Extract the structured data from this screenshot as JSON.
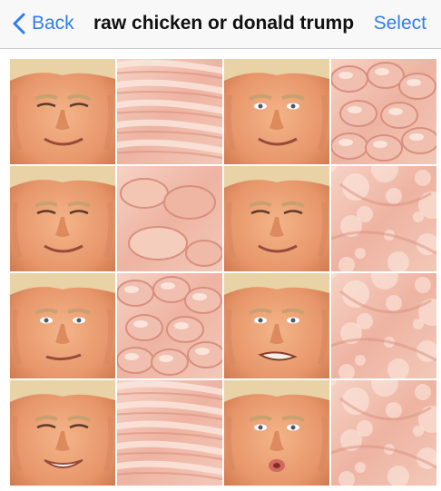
{
  "nav": {
    "back_label": "Back",
    "title": "raw chicken or donald trump",
    "select_label": "Select",
    "accent_color": "#2f7cf6"
  },
  "grid": {
    "rows": 4,
    "columns": 4,
    "tiles": [
      {
        "kind": "face",
        "expression": "smile-closed-eyes",
        "name": "photo-trump-face"
      },
      {
        "kind": "chicken",
        "variant": "breast-fillets",
        "name": "photo-raw-chicken"
      },
      {
        "kind": "face",
        "expression": "smile",
        "name": "photo-trump-face"
      },
      {
        "kind": "chicken",
        "variant": "chunks",
        "name": "photo-raw-chicken"
      },
      {
        "kind": "face",
        "expression": "grin-squint",
        "name": "photo-trump-face"
      },
      {
        "kind": "chicken",
        "variant": "drumsticks",
        "name": "photo-raw-chicken"
      },
      {
        "kind": "face",
        "expression": "squint",
        "name": "photo-trump-face"
      },
      {
        "kind": "chicken",
        "variant": "skin-closeup",
        "name": "photo-raw-chicken"
      },
      {
        "kind": "face",
        "expression": "smirk",
        "name": "photo-trump-face"
      },
      {
        "kind": "chicken",
        "variant": "diced",
        "name": "photo-raw-chicken"
      },
      {
        "kind": "face",
        "expression": "grimace",
        "name": "photo-trump-face"
      },
      {
        "kind": "chicken",
        "variant": "bumpy-skin",
        "name": "photo-raw-chicken"
      },
      {
        "kind": "face",
        "expression": "wide-smile",
        "name": "photo-trump-face"
      },
      {
        "kind": "chicken",
        "variant": "sliced",
        "name": "photo-raw-chicken"
      },
      {
        "kind": "face",
        "expression": "pout",
        "name": "photo-trump-face"
      },
      {
        "kind": "chicken",
        "variant": "skin-folds",
        "name": "photo-raw-chicken"
      }
    ]
  }
}
